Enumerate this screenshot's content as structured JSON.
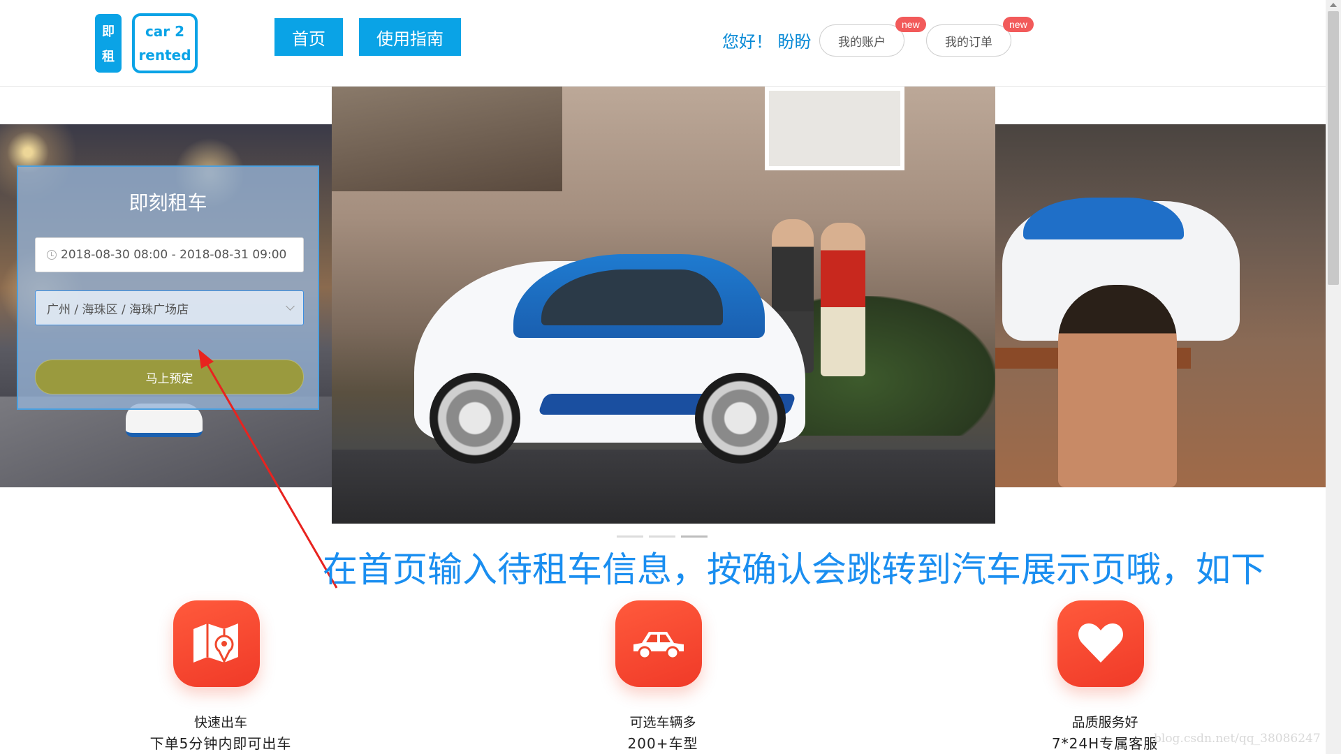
{
  "header": {
    "logo_left": [
      "即",
      "租"
    ],
    "logo_right": [
      "car 2",
      "rented"
    ],
    "nav": {
      "home": "首页",
      "guide": "使用指南"
    },
    "greeting": "您好！ 盼盼",
    "account_label": "我的账户",
    "orders_label": "我的订单",
    "badge_new": "new"
  },
  "booking": {
    "title": "即刻租车",
    "date_range": "2018-08-30 08:00  - 2018-08-31 09:00",
    "location": "广州 / 海珠区 / 海珠广场店",
    "submit_label": "马上预定"
  },
  "annotation": {
    "text": "在首页输入待租车信息，按确认会跳转到汽车展示页哦，如下",
    "color": "#1a8ef0",
    "arrow_color": "#e8231f"
  },
  "features": [
    {
      "icon": "map-pin-icon",
      "title": "快速出车",
      "subtitle": "下单5分钟内即可出车"
    },
    {
      "icon": "car-icon",
      "title": "可选车辆多",
      "subtitle": "200+车型"
    },
    {
      "icon": "heart-icon",
      "title": "品质服务好",
      "subtitle": "7*24H专属客服"
    }
  ],
  "carousel": {
    "slide_count": 3,
    "active_index": 2
  },
  "watermark": "blog.csdn.net/qq_38086247",
  "colors": {
    "brand": "#0aa3e6",
    "badge": "#f25a5a",
    "feature": "#f5452c"
  }
}
